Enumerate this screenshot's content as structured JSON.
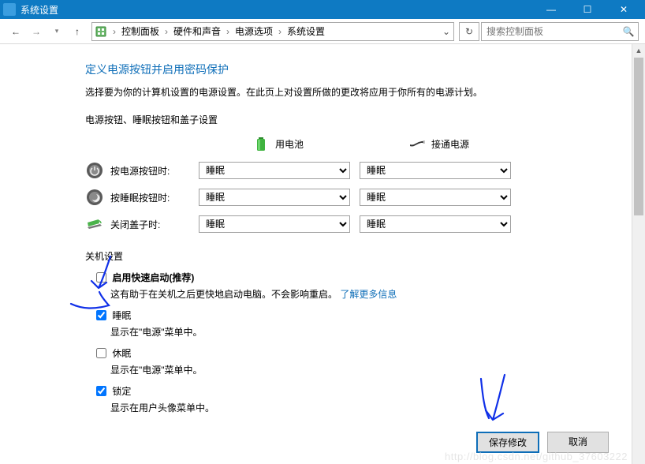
{
  "window": {
    "title": "系统设置"
  },
  "winControls": {
    "min": "—",
    "max": "☐",
    "close": "✕"
  },
  "nav": {
    "crumbs": [
      "控制面板",
      "硬件和声音",
      "电源选项",
      "系统设置"
    ],
    "searchPlaceholder": "搜索控制面板"
  },
  "page": {
    "heading": "定义电源按钮并启用密码保护",
    "intro": "选择要为你的计算机设置的电源设置。在此页上对设置所做的更改将应用于你所有的电源计划。",
    "powerSection": {
      "title": "电源按钮、睡眠按钮和盖子设置",
      "batteryLabel": "用电池",
      "pluggedLabel": "接通电源",
      "rows": [
        {
          "label": "按电源按钮时:",
          "battery": "睡眠",
          "plugged": "睡眠",
          "icon": "power"
        },
        {
          "label": "按睡眠按钮时:",
          "battery": "睡眠",
          "plugged": "睡眠",
          "icon": "sleep"
        },
        {
          "label": "关闭盖子时:",
          "battery": "睡眠",
          "plugged": "睡眠",
          "icon": "lid"
        }
      ]
    },
    "shutdownSection": {
      "title": "关机设置",
      "items": [
        {
          "checked": false,
          "label": "启用快速启动(推荐)",
          "bold": true,
          "sub": "这有助于在关机之后更快地启动电脑。不会影响重启。",
          "linkText": "了解更多信息"
        },
        {
          "checked": true,
          "label": "睡眠",
          "bold": false,
          "sub": "显示在\"电源\"菜单中。"
        },
        {
          "checked": false,
          "label": "休眠",
          "bold": false,
          "sub": "显示在\"电源\"菜单中。"
        },
        {
          "checked": true,
          "label": "锁定",
          "bold": false,
          "sub": "显示在用户头像菜单中。"
        }
      ]
    },
    "buttons": {
      "save": "保存修改",
      "cancel": "取消"
    }
  },
  "watermark": "http://blog.csdn.net/github_37603222"
}
